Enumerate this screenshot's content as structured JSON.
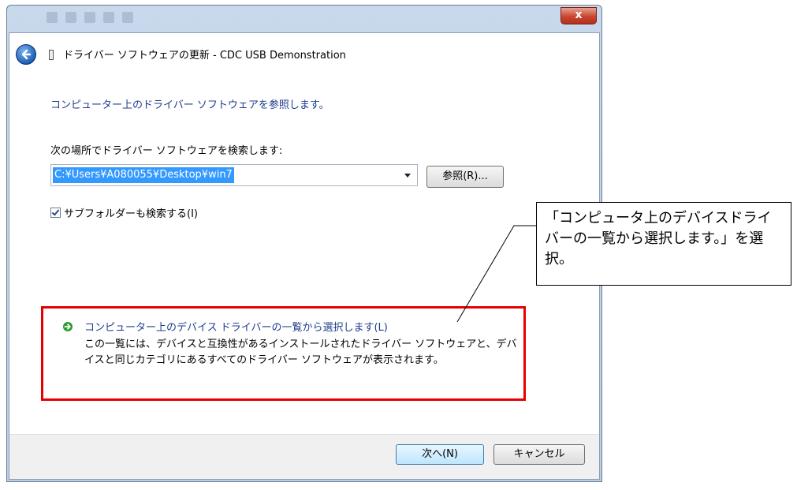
{
  "window": {
    "title": "ドライバー ソフトウェアの更新 - CDC USB Demonstration",
    "close_label": "x"
  },
  "content": {
    "heading": "コンピューター上のドライバー ソフトウェアを参照します。",
    "search_label": "次の場所でドライバー ソフトウェアを検索します:",
    "path_value": "C:¥Users¥A080055¥Desktop¥win7",
    "browse_button": "参照(R)...",
    "include_subfolders": {
      "label": "サブフォルダーも検索する(I)",
      "checked": true
    },
    "pick_option": {
      "title": "コンピューター上のデバイス ドライバーの一覧から選択します(L)",
      "description": "この一覧には、デバイスと互換性があるインストールされたドライバー ソフトウェアと、デバイスと同じカテゴリにあるすべてのドライバー ソフトウェアが表示されます。"
    }
  },
  "footer": {
    "next_button": "次へ(N)",
    "cancel_button": "キャンセル"
  },
  "callout": {
    "text": "「コンピュータ上のデバイスドライバーの一覧から選択します。」を選択。"
  },
  "colors": {
    "link_blue": "#1c3c8c",
    "highlight_red": "#e60000",
    "selection_blue": "#3399ff"
  }
}
